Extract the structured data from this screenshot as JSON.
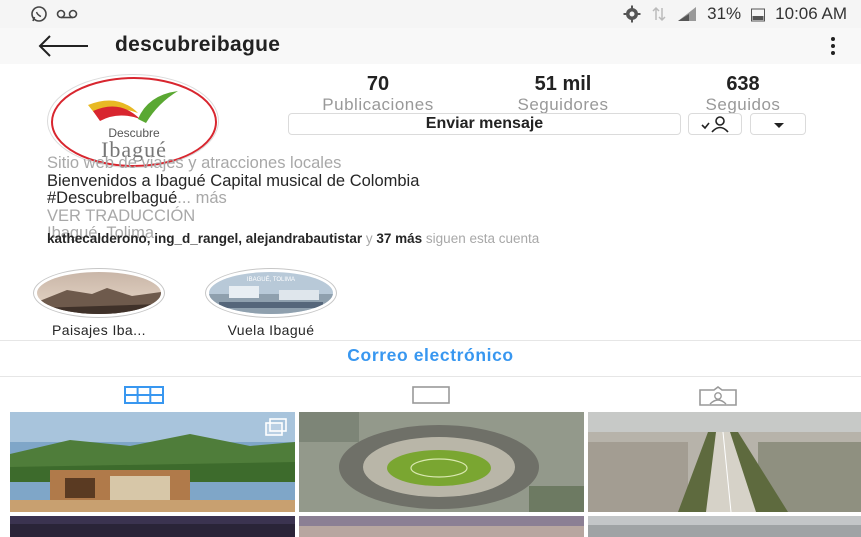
{
  "status_bar": {
    "battery": "31%",
    "time": "10:06 AM"
  },
  "header": {
    "username": "descubreibague"
  },
  "profile": {
    "logo_text": "Descubre Ibagué",
    "stats": [
      {
        "value": "70",
        "label": "Publicaciones"
      },
      {
        "value": "51 mil",
        "label": "Seguidores"
      },
      {
        "value": "638",
        "label": "Seguidos"
      }
    ],
    "message_button": "Enviar mensaje"
  },
  "bio": {
    "category": "Sitio web de viajes y atracciones locales",
    "line1": "Bienvenidos a Ibagué Capital musical de Colombia",
    "hashtag": "#DescubreIbagué",
    "ellipsis": "...",
    "more": " más",
    "translate": "VER TRADUCCIÓN",
    "location": "Ibagué, Tolima",
    "followed_by_names": "kathecalderono, ing_d_rangel, alejandrabautistar",
    "followed_by_y": " y ",
    "followed_by_count": "37 más",
    "followed_by_suffix": " siguen esta cuenta"
  },
  "highlights": [
    {
      "label": "Paisajes Iba..."
    },
    {
      "label": "Vuela Ibagué",
      "image_text": "IBAGUÉ, TOLIMA"
    }
  ],
  "contact": {
    "email_label": "Correo electrónico"
  },
  "tabs": [
    {
      "icon": "grid-icon",
      "active": true
    },
    {
      "icon": "feed-icon",
      "active": false
    },
    {
      "icon": "tagged-icon",
      "active": false
    }
  ],
  "colors": {
    "link": "#3897f0",
    "muted": "#a8a8a8"
  }
}
